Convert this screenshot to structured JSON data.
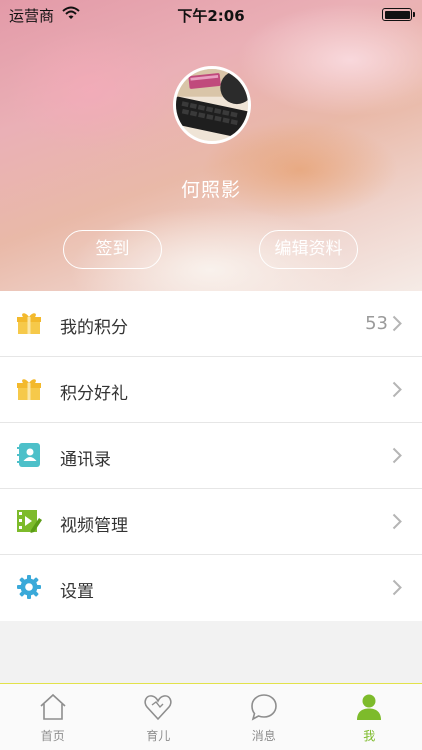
{
  "status_bar": {
    "carrier": "运营商",
    "time": "下午2:06"
  },
  "profile": {
    "username": "何照影",
    "checkin_label": "签到",
    "edit_label": "编辑资料"
  },
  "menu": {
    "items": [
      {
        "label": "我的积分",
        "value": "53",
        "icon": "gift-icon",
        "color": "#f6c94a"
      },
      {
        "label": "积分好礼",
        "value": "",
        "icon": "gift-icon",
        "color": "#f6c94a"
      },
      {
        "label": "通讯录",
        "value": "",
        "icon": "contacts-book-icon",
        "color": "#4dc0c9"
      },
      {
        "label": "视频管理",
        "value": "",
        "icon": "video-edit-icon",
        "color": "#7dbb2b"
      },
      {
        "label": "设置",
        "value": "",
        "icon": "gear-icon",
        "color": "#3aa9d9"
      }
    ]
  },
  "tab_bar": {
    "tabs": [
      {
        "label": "首页",
        "icon": "home-icon",
        "active": false
      },
      {
        "label": "育儿",
        "icon": "heart-icon",
        "active": false
      },
      {
        "label": "消息",
        "icon": "chat-bubble-icon",
        "active": false
      },
      {
        "label": "我",
        "icon": "person-icon",
        "active": true
      }
    ],
    "active_color": "#7dbb2b",
    "inactive_color": "#8e8e8e"
  }
}
